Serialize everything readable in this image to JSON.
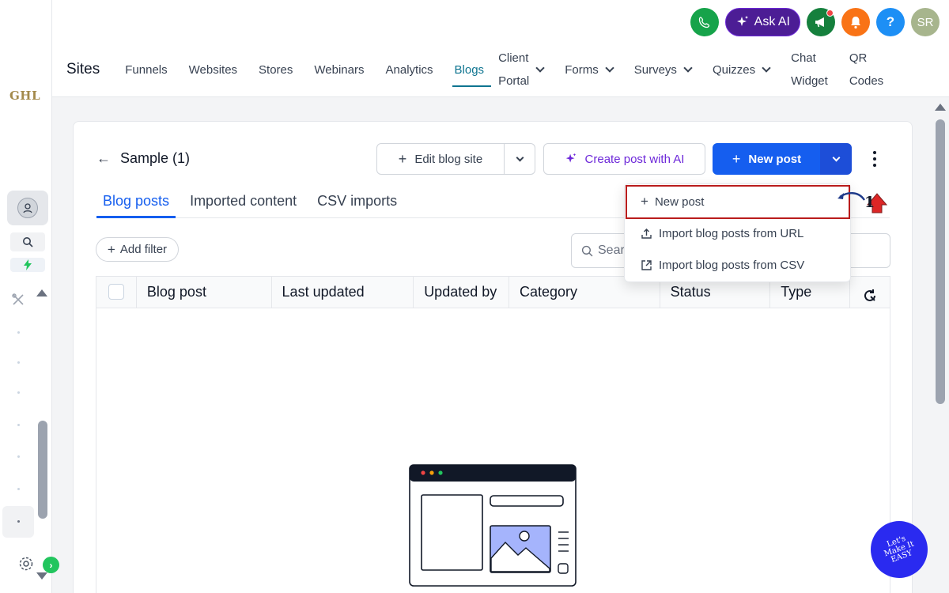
{
  "brand": {
    "logo_text": "GHL"
  },
  "topbar": {
    "ask_ai_label": "Ask AI",
    "help_label": "?",
    "user_initials": "SR"
  },
  "nav": {
    "sites_label": "Sites",
    "items": [
      {
        "label": "Funnels"
      },
      {
        "label": "Websites"
      },
      {
        "label": "Stores"
      },
      {
        "label": "Webinars"
      },
      {
        "label": "Analytics"
      },
      {
        "label": "Blogs",
        "active": true
      },
      {
        "label_line1": "Client",
        "label_line2": "Portal",
        "dropdown": true
      },
      {
        "label": "Forms",
        "dropdown": true
      },
      {
        "label": "Surveys",
        "dropdown": true
      },
      {
        "label": "Quizzes",
        "dropdown": true
      },
      {
        "label_line1": "Chat",
        "label_line2": "Widget"
      },
      {
        "label_line1": "QR",
        "label_line2": "Codes"
      }
    ]
  },
  "page": {
    "title": "Sample (1)",
    "edit_blog_site_label": "Edit blog site",
    "create_post_ai_label": "Create post with AI",
    "new_post_label": "New post"
  },
  "tabs": [
    {
      "label": "Blog posts",
      "active": true
    },
    {
      "label": "Imported content"
    },
    {
      "label": "CSV imports"
    }
  ],
  "filters": {
    "add_filter_label": "Add filter",
    "search_placeholder": "Sear"
  },
  "table": {
    "columns": [
      "Blog post",
      "Last updated",
      "Updated by",
      "Category",
      "Status",
      "Type"
    ]
  },
  "dropdown_menu": {
    "items": [
      {
        "label": "New post",
        "icon": "plus-icon"
      },
      {
        "label": "Import blog posts from URL",
        "icon": "upload-icon"
      },
      {
        "label": "Import blog posts from CSV",
        "icon": "external-upload-icon"
      }
    ]
  },
  "annotation": {
    "number": "1"
  },
  "watermark": {
    "text": "Let's Make It EASY"
  },
  "colors": {
    "primary": "#155eef",
    "ai_purple": "#6d28d9",
    "active_nav": "#0e7490",
    "highlight_red": "#b91c1c"
  }
}
